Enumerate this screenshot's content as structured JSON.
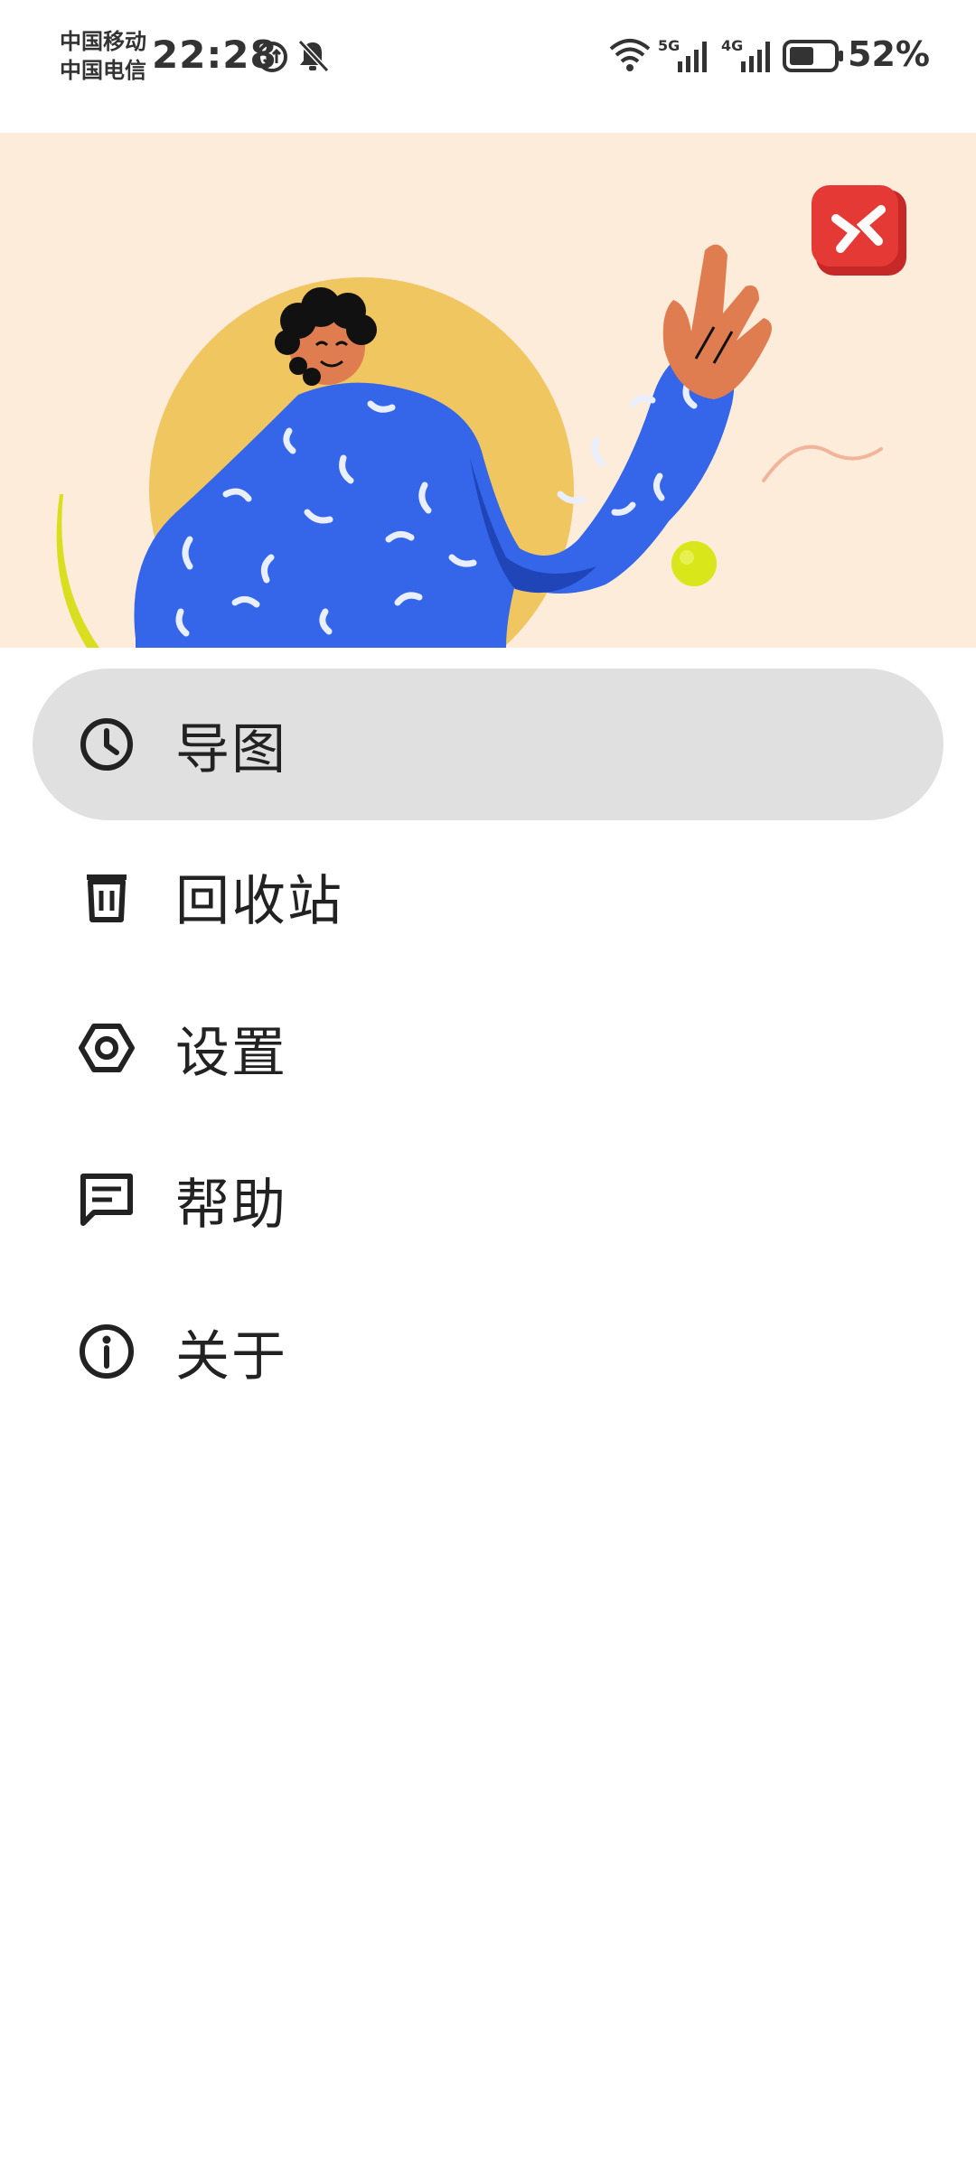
{
  "status_bar": {
    "carrier_1": "中国移动",
    "carrier_2": "中国电信",
    "time": "22:28",
    "network_1": "5G",
    "network_2": "4G",
    "battery_percent": "52%",
    "icons": [
      "data-saver-icon",
      "bell-muted-icon",
      "wifi-icon",
      "signal-5g-icon",
      "signal-4g-icon",
      "battery-icon"
    ]
  },
  "banner": {
    "illustration": "person-waving-illustration",
    "colors": {
      "background": "#fdecd9",
      "sun": "#f0c660",
      "sweater": "#3565e8",
      "skin": "#e07d50",
      "cube": "#e53935",
      "ball": "#d8e61a"
    }
  },
  "menu": {
    "items": [
      {
        "label": "导图",
        "icon": "clock-icon",
        "active": true
      },
      {
        "label": "回收站",
        "icon": "trash-icon",
        "active": false
      },
      {
        "label": "设置",
        "icon": "settings-hexagon-icon",
        "active": false
      },
      {
        "label": "帮助",
        "icon": "chat-icon",
        "active": false
      },
      {
        "label": "关于",
        "icon": "info-icon",
        "active": false
      }
    ],
    "active_background": "#e0e0e0"
  }
}
